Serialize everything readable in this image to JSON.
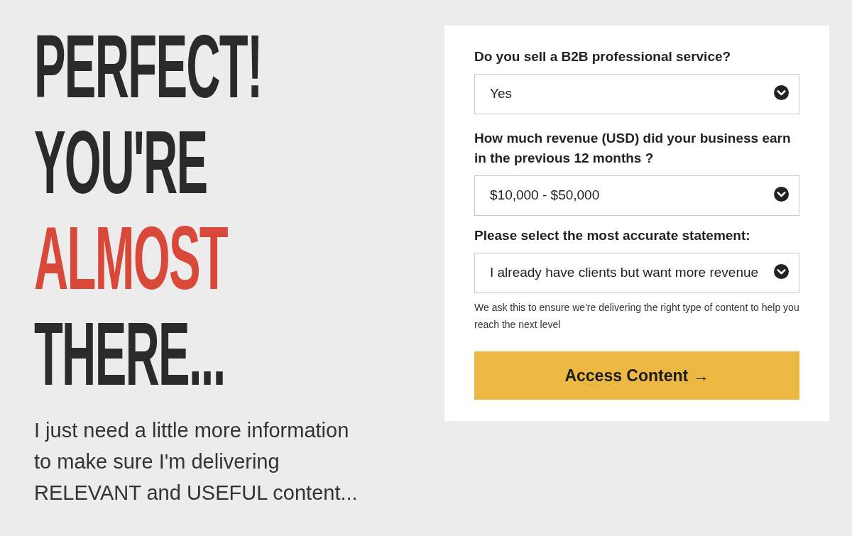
{
  "headline": [
    {
      "text": "PERFECT!",
      "accent": false
    },
    {
      "text": "YOU'RE",
      "accent": false
    },
    {
      "text": "ALMOST",
      "accent": true
    },
    {
      "text": "THERE...",
      "accent": false
    }
  ],
  "intro": "I just need a little more information to make sure I'm delivering RELEVANT and USEFUL content...",
  "form": {
    "fields": [
      {
        "label": "Do you sell a B2B professional service?",
        "value": "Yes"
      },
      {
        "label": "How much revenue (USD) did your business earn in the previous 12 months ?",
        "value": "$10,000 - $50,000"
      },
      {
        "label": "Please select the most accurate statement:",
        "value": "I already have clients but want more revenue"
      }
    ],
    "note": "We ask this to ensure we're delivering the right type of content to help you reach the next level",
    "button": "Access Content →"
  }
}
